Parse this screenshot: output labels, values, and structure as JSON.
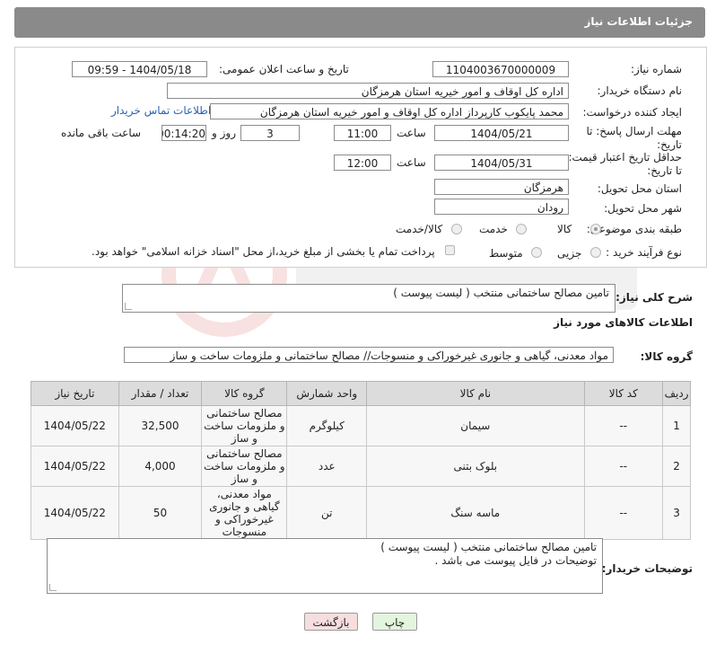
{
  "header": {
    "title": "جزئیات اطلاعات نیاز"
  },
  "form": {
    "need_number_label": "شماره نیاز:",
    "need_number": "1104003670000009",
    "announce_label": "تاریخ و ساعت اعلان عمومی:",
    "announce_value": "1404/05/18 - 09:59",
    "buyer_org_label": "نام دستگاه خریدار:",
    "buyer_org": "اداره کل اوقاف و امور خیریه استان هرمزگان",
    "requester_label": "ایجاد کننده درخواست:",
    "requester": "محمد پایکوب کارپرداز اداره کل اوقاف و امور خیریه استان هرمزگان",
    "contact_link": "اطلاعات تماس خریدار",
    "reply_deadline_label_1": "مهلت ارسال پاسخ: تا",
    "reply_deadline_label_2": "تاریخ:",
    "reply_date": "1404/05/21",
    "time_label": "ساعت",
    "reply_time": "11:00",
    "days_value": "3",
    "days_label": "روز و",
    "remaining_time": "00:14:20",
    "remaining_label": "ساعت باقی مانده",
    "validity_label_1": "حداقل تاریخ اعتبار قیمت:",
    "validity_label_2": "تا تاریخ:",
    "validity_date": "1404/05/31",
    "validity_time": "12:00",
    "province_label": "استان محل تحویل:",
    "province": "هرمزگان",
    "city_label": "شهر محل تحویل:",
    "city": "رودان",
    "category_label": "طبقه بندی موضوعی:",
    "category_options": [
      "کالا",
      "خدمت",
      "کالا/خدمت"
    ],
    "purchase_type_label": "نوع فرآیند خرید :",
    "purchase_options": [
      "جزیی",
      "متوسط"
    ],
    "payment_note": "پرداخت تمام یا بخشی از مبلغ خرید،از محل \"اسناد خزانه اسلامی\" خواهد بود."
  },
  "summary": {
    "label": "شرح کلی نیاز:",
    "value": "تامین مصالح ساختمانی منتخب ( لیست پیوست )"
  },
  "goods": {
    "section_title": "اطلاعات کالاهای مورد نیاز",
    "group_label": "گروه کالا:",
    "group_value": "مواد معدنی، گیاهی و جانوری غیرخوراکی و منسوجات// مصالح ساختمانی و ملزومات ساخت و ساز",
    "columns": [
      "ردیف",
      "کد کالا",
      "نام کالا",
      "واحد شمارش",
      "گروه کالا",
      "تعداد / مقدار",
      "تاریخ نیاز"
    ],
    "rows": [
      {
        "row": "1",
        "code": "--",
        "name": "سیمان",
        "unit": "کیلوگرم",
        "group": "مصالح ساختمانی و ملزومات ساخت و ساز",
        "qty": "32,500",
        "date": "1404/05/22"
      },
      {
        "row": "2",
        "code": "--",
        "name": "بلوک بتنی",
        "unit": "عدد",
        "group": "مصالح ساختمانی و ملزومات ساخت و ساز",
        "qty": "4,000",
        "date": "1404/05/22"
      },
      {
        "row": "3",
        "code": "--",
        "name": "ماسه سنگ",
        "unit": "تن",
        "group": "مواد معدنی، گیاهی و جانوری غیرخوراکی و منسوجات",
        "qty": "50",
        "date": "1404/05/22"
      }
    ]
  },
  "buyer_notes": {
    "label": "توضیحات خریدار:",
    "line1": "تامین مصالح ساختمانی منتخب ( لیست پیوست )",
    "line2": "توضیحات در فایل پیوست می باشد ."
  },
  "buttons": {
    "print": "چاپ",
    "back": "بازگشت"
  },
  "colors": {
    "header_bg": "#8a8a8a",
    "print_bg": "#e3f5dc",
    "back_bg": "#f7dede",
    "link": "#2a62b5"
  }
}
